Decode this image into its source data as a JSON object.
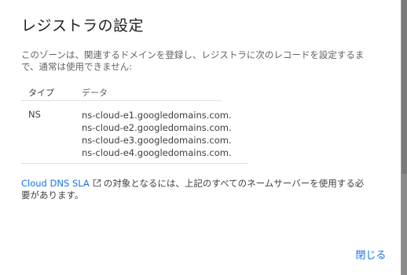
{
  "dialog": {
    "title": "レジストラの設定",
    "description": "このゾーンは、関連するドメインを登録し、レジストラに次のレコードを設定するまで、通常は使用できません:",
    "table": {
      "headers": {
        "type": "タイプ",
        "data": "データ"
      },
      "rows": [
        {
          "type": "NS",
          "data": [
            "ns-cloud-e1.googledomains.com.",
            "ns-cloud-e2.googledomains.com.",
            "ns-cloud-e3.googledomains.com.",
            "ns-cloud-e4.googledomains.com."
          ]
        }
      ]
    },
    "sla_link": "Cloud DNS SLA",
    "sla_text": "の対象となるには、上記のすべてのネームサーバーを使用する必要があります。",
    "close_label": "閉じる"
  },
  "colors": {
    "accent": "#1a73e8",
    "text_primary": "#202124",
    "text_secondary": "#5f6368",
    "backdrop": "#6b6b6b"
  }
}
